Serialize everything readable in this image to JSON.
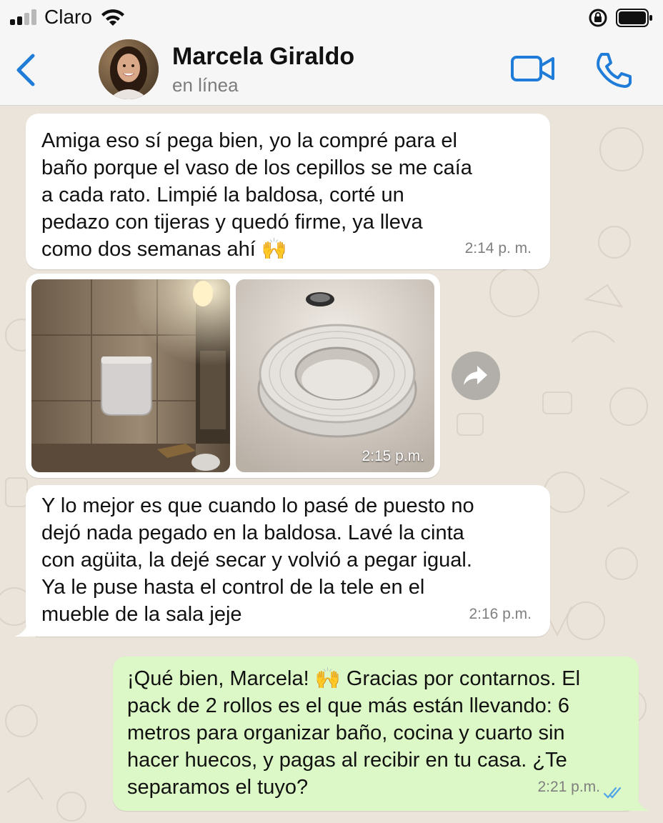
{
  "status_bar": {
    "carrier": "Claro"
  },
  "header": {
    "contact_name": "Marcela Giraldo",
    "contact_status": "en línea"
  },
  "messages": [
    {
      "direction": "in",
      "text": "Amiga eso sí pega bien, yo la compré para el\nbaño porque el vaso de los cepillos se me caía\na cada rato. Limpié la baldosa, corté un\npedazo con tijeras y quedó firme, ya lleva\ncomo dos semanas ahí 🙌",
      "time": "2:14 p. m."
    },
    {
      "direction": "in",
      "type": "photos",
      "time": "2:15 p.m."
    },
    {
      "direction": "in",
      "text": "Y lo mejor es que cuando lo pasé de puesto no\ndejó nada pegado en la baldosa. Lavé la cinta\ncon agüita, la dejé secar y volvió a pegar igual.\nYa le puse hasta el control de la tele en el\nmueble de la sala jeje",
      "time": "2:16 p.m."
    },
    {
      "direction": "out",
      "text": "¡Qué bien, Marcela! 🙌 Gracias por contarnos. El\npack de 2 rollos es el que más están llevando: 6\nmetros para organizar baño, cocina y cuarto sin\nhacer huecos, y pagas al recibir en tu casa. ¿Te\nseparamos el tuyo?",
      "time": "2:21 p.m.",
      "read": true
    }
  ],
  "colors": {
    "accent": "#1f7cd8",
    "incoming_bubble": "#ffffff",
    "outgoing_bubble": "#dcf8c6",
    "chat_background": "#ebe4da",
    "read_ticks": "#4fa3e8"
  }
}
